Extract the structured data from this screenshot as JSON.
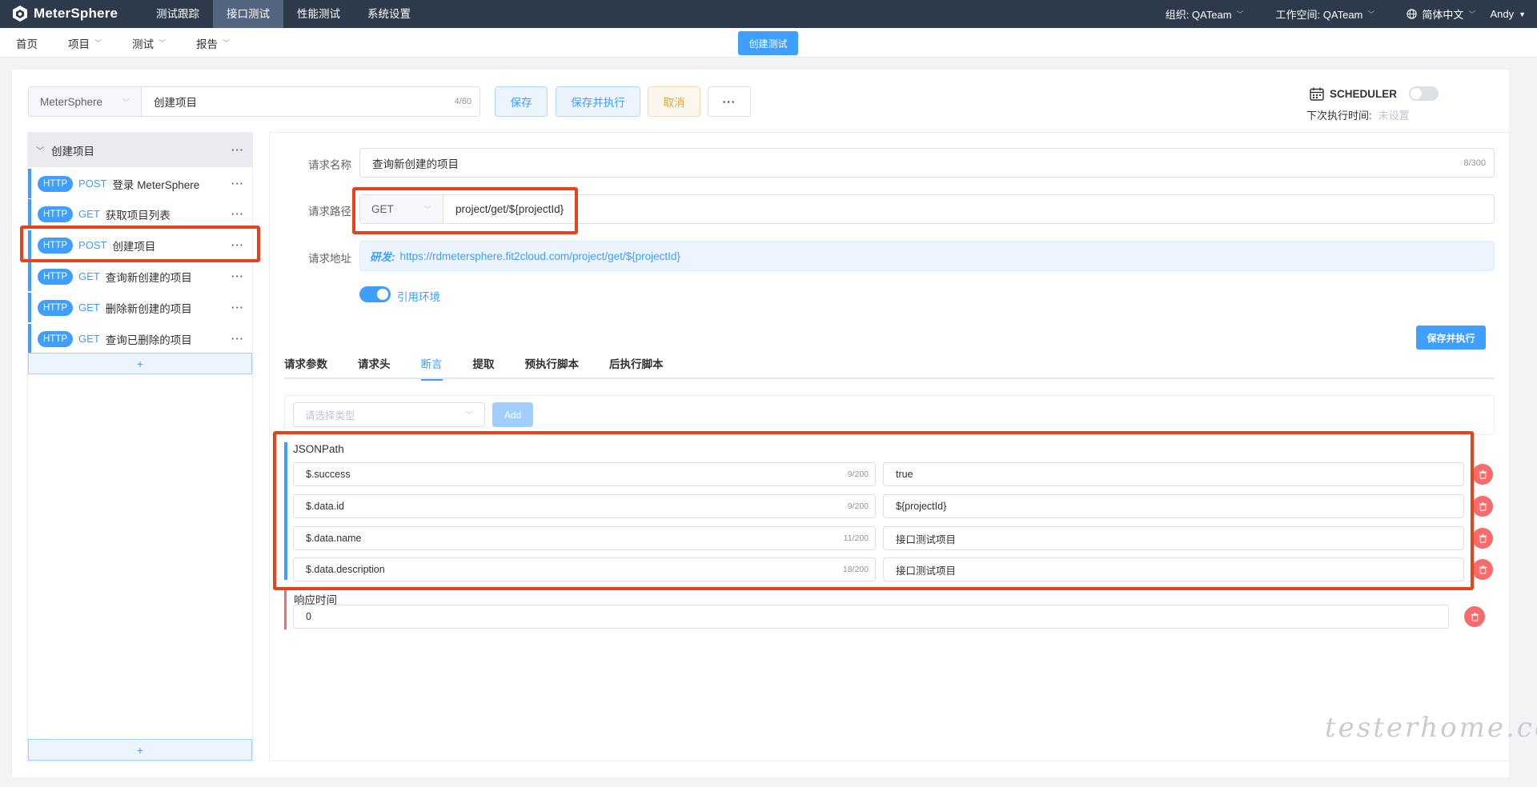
{
  "app": {
    "name": "MeterSphere"
  },
  "topnav": [
    "测试跟踪",
    "接口测试",
    "性能测试",
    "系统设置"
  ],
  "topnav_active": "接口测试",
  "topright": {
    "org": "组织: QATeam",
    "workspace": "工作空间: QATeam",
    "language": "简体中文",
    "user": "Andy"
  },
  "subnav": {
    "home": "首页",
    "project": "项目",
    "test": "测试",
    "report": "报告",
    "create_label": "创建测试"
  },
  "scenario": {
    "project_select": "MeterSphere",
    "name": "创建项目",
    "name_count": "4/60",
    "buttons": {
      "save": "保存",
      "save_run": "保存并执行",
      "cancel": "取消",
      "more": "···"
    }
  },
  "scheduler": {
    "label": "SCHEDULER",
    "next_label": "下次执行时间:",
    "next_value": "未设置"
  },
  "tree": {
    "root": "创建项目",
    "items": [
      {
        "tag": "HTTP",
        "method": "POST",
        "name": "登录 MeterSphere"
      },
      {
        "tag": "HTTP",
        "method": "GET",
        "name": "获取项目列表"
      },
      {
        "tag": "HTTP",
        "method": "POST",
        "name": "创建项目"
      },
      {
        "tag": "HTTP",
        "method": "GET",
        "name": "查询新创建的项目"
      },
      {
        "tag": "HTTP",
        "method": "GET",
        "name": "删除新创建的项目"
      },
      {
        "tag": "HTTP",
        "method": "GET",
        "name": "查询已删除的项目"
      }
    ],
    "add": "+"
  },
  "request": {
    "name_label": "请求名称",
    "name": "查询新创建的项目",
    "name_count": "8/300",
    "path_label": "请求路径",
    "method": "GET",
    "path": "project/get/${projectId}",
    "url_label": "请求地址",
    "env_name": "研发:",
    "url": "https://rdmetersphere.fit2cloud.com/project/get/${projectId}",
    "use_env_label": "引用环境",
    "use_env": true,
    "save_run": "保存并执行"
  },
  "tabs": [
    "请求参数",
    "请求头",
    "断言",
    "提取",
    "预执行脚本",
    "后执行脚本"
  ],
  "tabs_active": "断言",
  "assertions": {
    "type_placeholder": "请选择类型",
    "add_label": "Add",
    "jsonpath_title": "JSONPath",
    "jsonpath": [
      {
        "expression": "$.success",
        "count": "9/200",
        "expect": "true"
      },
      {
        "expression": "$.data.id",
        "count": "9/200",
        "expect": "${projectId}"
      },
      {
        "expression": "$.data.name",
        "count": "11/200",
        "expect": "接口测试项目"
      },
      {
        "expression": "$.data.description",
        "count": "18/200",
        "expect": "接口测试项目"
      }
    ],
    "response_time_title": "响应时间",
    "response_time": "0"
  },
  "watermark": "testerhome.com",
  "colors": {
    "primary": "#409eff",
    "topbar": "#2d3a4b",
    "danger": "#f56c6c",
    "highlight": "#e8421c"
  }
}
